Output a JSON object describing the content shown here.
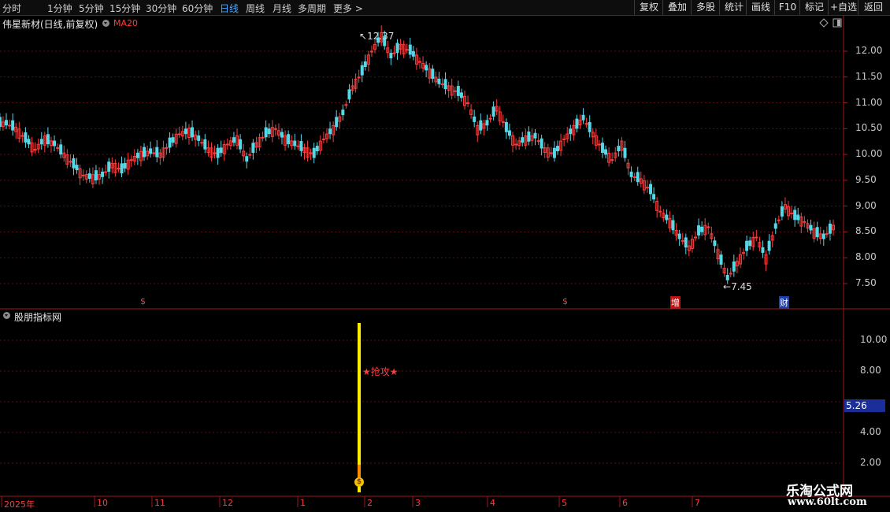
{
  "toolbar": {
    "periods": [
      "分时",
      "1分钟",
      "5分钟",
      "15分钟",
      "30分钟",
      "60分钟",
      "日线",
      "周线",
      "月线",
      "多周期",
      "更多"
    ],
    "active_period": "日线",
    "right_buttons": [
      "复权",
      "叠加",
      "多股",
      "统计",
      "画线",
      "F10",
      "标记",
      "+自选",
      "返回"
    ]
  },
  "main_chart": {
    "title": "伟星新材(日线,前复权)",
    "indicator": "MA20",
    "high_label": "12.37",
    "low_label": "7.45",
    "price_axis": [
      "12.00",
      "11.50",
      "11.00",
      "10.50",
      "10.00",
      "9.50",
      "9.00",
      "8.50",
      "8.00",
      "7.50"
    ],
    "markers": [
      {
        "text": "$",
        "color": "#ff3b3b"
      },
      {
        "text": "$",
        "color": "#ff3b3b"
      },
      {
        "text": "增",
        "color": "#ffffff",
        "bg": "#c01010"
      },
      {
        "text": "财",
        "color": "#ffffff",
        "bg": "#1a3fb0"
      }
    ]
  },
  "sub_chart": {
    "title": "股朋指标网",
    "axis": [
      "10.00",
      "8.00",
      "4.00",
      "2.00"
    ],
    "current_value": "5.26",
    "signal_label": "★抢攻★",
    "signal_icon_text": "$"
  },
  "date_axis": [
    "2025年",
    "10",
    "11",
    "12",
    "1",
    "2",
    "3",
    "4",
    "5",
    "6",
    "7"
  ],
  "watermark": {
    "line1": "乐淘公式网",
    "line2": "www.60lt.com"
  },
  "chart_data": {
    "type": "candlestick",
    "symbol_title": "伟星新材(日线,前复权)",
    "ylim": [
      7.2,
      12.6
    ],
    "close_series_approx": [
      10.6,
      10.5,
      10.3,
      10.1,
      10.3,
      10.2,
      10.0,
      9.8,
      9.6,
      9.55,
      9.6,
      9.8,
      9.7,
      9.9,
      10.0,
      10.05,
      10.0,
      10.2,
      10.4,
      10.45,
      10.3,
      10.1,
      10.0,
      10.2,
      10.3,
      9.9,
      10.2,
      10.4,
      10.5,
      10.3,
      10.2,
      10.1,
      10.0,
      10.3,
      10.5,
      10.8,
      11.3,
      11.6,
      12.0,
      12.3,
      11.9,
      12.1,
      12.0,
      11.8,
      11.6,
      11.4,
      11.3,
      11.2,
      11.0,
      10.5,
      10.6,
      10.9,
      10.5,
      10.2,
      10.3,
      10.35,
      10.1,
      10.0,
      10.3,
      10.5,
      10.7,
      10.4,
      10.1,
      9.9,
      10.2,
      9.6,
      9.5,
      9.3,
      8.9,
      8.7,
      8.4,
      8.2,
      8.5,
      8.6,
      8.1,
      7.6,
      7.9,
      8.2,
      8.4,
      8.0,
      8.6,
      9.0,
      8.8,
      8.7,
      8.5,
      8.4,
      8.6
    ]
  }
}
